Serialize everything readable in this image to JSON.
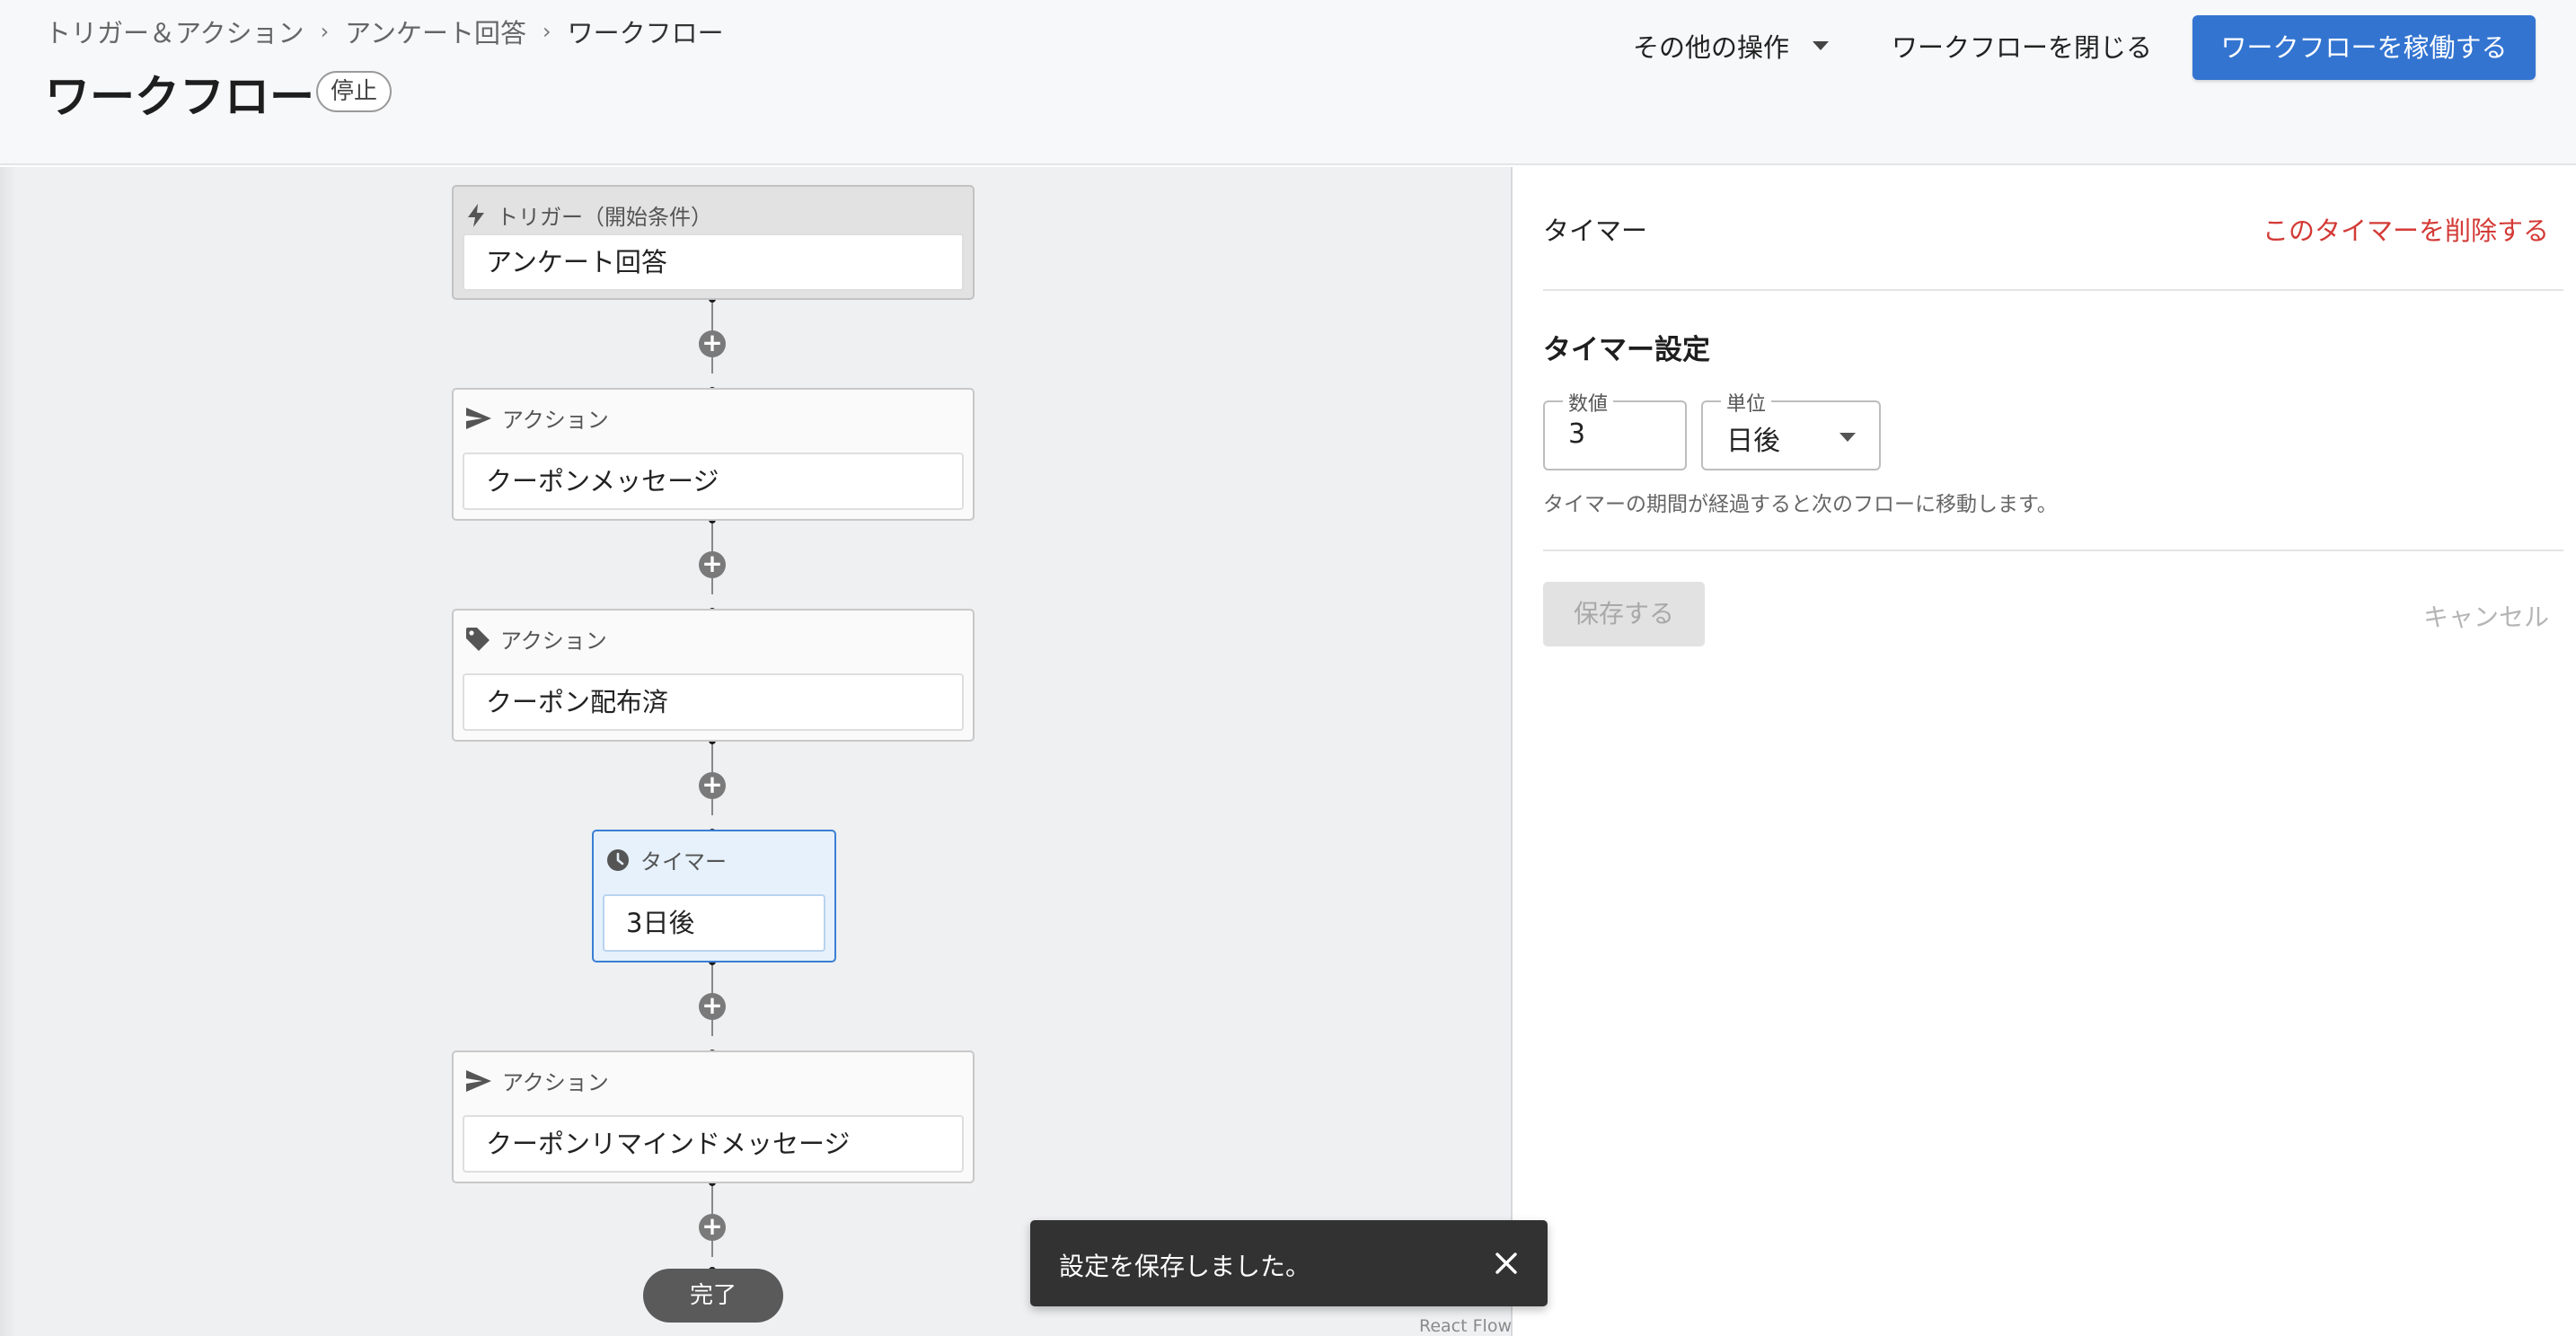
{
  "header": {
    "breadcrumb": [
      "トリガー＆アクション",
      "アンケート回答",
      "ワークフロー"
    ],
    "breadcrumb_separator": "›",
    "title": "ワークフロー",
    "status_badge": "停止",
    "more_actions_label": "その他の操作",
    "close_label": "ワークフローを閉じる",
    "activate_label": "ワークフローを稼働する"
  },
  "flow": {
    "add_symbol": "+",
    "nodes": [
      {
        "type": "trigger",
        "icon": "lightning-icon",
        "head": "トリガー（開始条件）",
        "body": "アンケート回答"
      },
      {
        "type": "action",
        "icon": "send-icon",
        "head": "アクション",
        "body": "クーポンメッセージ"
      },
      {
        "type": "action",
        "icon": "tag-icon",
        "head": "アクション",
        "body": "クーポン配布済"
      },
      {
        "type": "timer",
        "icon": "clock-icon",
        "head": "タイマー",
        "body": "3日後"
      },
      {
        "type": "action",
        "icon": "send-icon",
        "head": "アクション",
        "body": "クーポンリマインドメッセージ"
      }
    ],
    "end_label": "完了",
    "attribution": "React Flow"
  },
  "panel": {
    "title": "タイマー",
    "delete_label": "このタイマーを削除する",
    "section_title": "タイマー設定",
    "value_label": "数値",
    "value": "3",
    "unit_label": "単位",
    "unit": "日後",
    "help_text": "タイマーの期間が経過すると次のフローに移動します。",
    "save_label": "保存する",
    "cancel_label": "キャンセル"
  },
  "toast": {
    "message": "設定を保存しました。"
  },
  "colors": {
    "primary": "#3374d1",
    "danger": "#d33a36",
    "timer_highlight": "#e6f1fb"
  }
}
